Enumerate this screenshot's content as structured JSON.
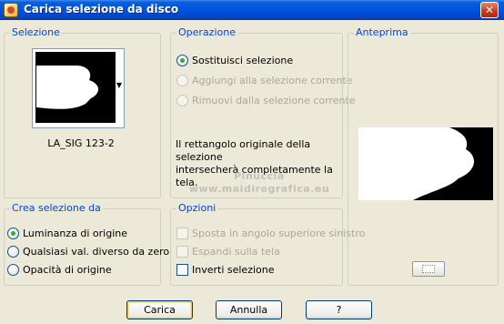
{
  "window": {
    "title": "Carica selezione da disco"
  },
  "selezione": {
    "heading": "Selezione",
    "selection_name": "LA_SIG 123-2"
  },
  "operazione": {
    "heading": "Operazione",
    "options": [
      {
        "label": "Sostituisci selezione",
        "checked": true,
        "enabled": true
      },
      {
        "label": "Aggiungi alla selezione corrente",
        "checked": false,
        "enabled": false
      },
      {
        "label": "Rimuovi dalla selezione corrente",
        "checked": false,
        "enabled": false
      }
    ],
    "info_line1": "Il rettangolo originale della selezione",
    "info_line2": "intersecherà completamente la tela."
  },
  "anteprima": {
    "heading": "Anteprima"
  },
  "crea": {
    "heading": "Crea selezione da",
    "options": [
      {
        "label": "Luminanza di origine",
        "checked": true
      },
      {
        "label": "Qualsiasi val. diverso da zero",
        "checked": false
      },
      {
        "label": "Opacità di origine",
        "checked": false
      }
    ]
  },
  "opzioni": {
    "heading": "Opzioni",
    "items": [
      {
        "label": "Sposta in angolo superiore sinistro",
        "checked": false,
        "enabled": false
      },
      {
        "label": "Espandi sulla tela",
        "checked": false,
        "enabled": false
      },
      {
        "label": "Inverti selezione",
        "checked": false,
        "enabled": true
      }
    ]
  },
  "watermark": {
    "line1": "Pinuccia",
    "line2": "www.maidiregrafica.eu"
  },
  "buttons": {
    "ok": "Carica",
    "cancel": "Annulla",
    "help": "?"
  },
  "icons": {
    "app": "app-icon",
    "close": "close-icon",
    "dropdown": "chevron-down-icon",
    "preview_toggle": "preview-toggle-icon"
  }
}
